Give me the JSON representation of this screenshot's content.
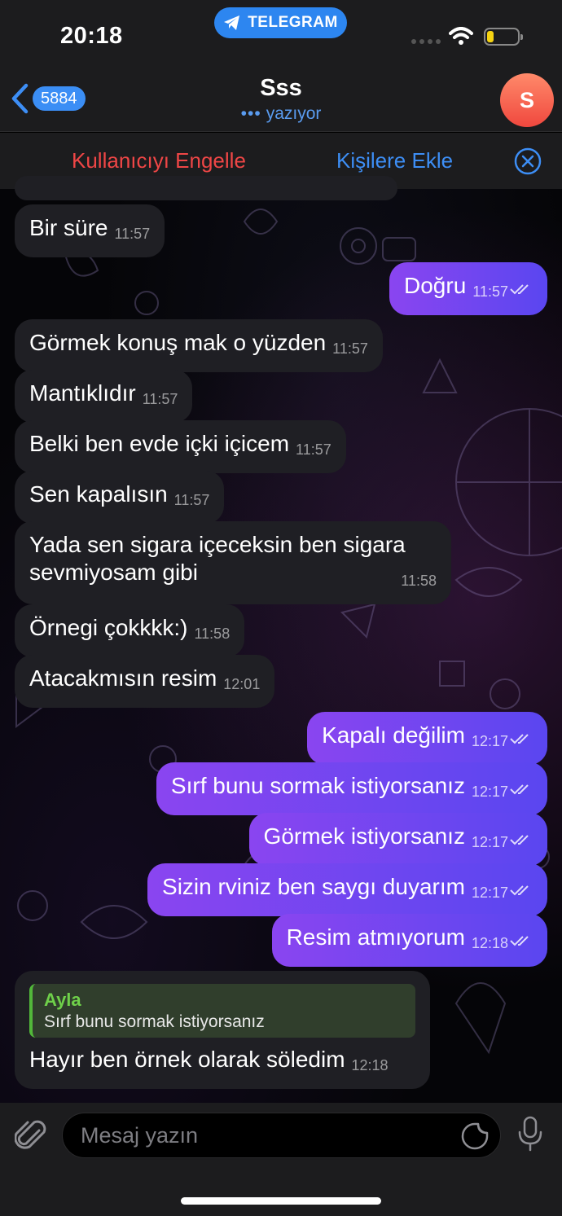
{
  "status_bar": {
    "time": "20:18",
    "app_pill": "TELEGRAM"
  },
  "header": {
    "back_count": "5884",
    "title": "Sss",
    "status": "yazıyor",
    "avatar_letter": "S",
    "avatar_color": "#f0483e"
  },
  "actions": {
    "block": "Kullanıcıyı Engelle",
    "add_contact": "Kişilere Ekle"
  },
  "messages": [
    {
      "dir": "in",
      "text": "Bir süre",
      "time": "11:57"
    },
    {
      "dir": "out",
      "text": "Doğru",
      "time": "11:57"
    },
    {
      "dir": "in",
      "text": "Görmek konuş mak o yüzden",
      "time": "11:57"
    },
    {
      "dir": "in",
      "text": "Mantıklıdır",
      "time": "11:57"
    },
    {
      "dir": "in",
      "text": "Belki ben evde içki içicem",
      "time": "11:57"
    },
    {
      "dir": "in",
      "text": "Sen kapalısın",
      "time": "11:57"
    },
    {
      "dir": "in",
      "text_line1": "Yada sen sigara içeceksin ben sigara",
      "text_line2": "sevmiyosam gibi",
      "time": "11:58"
    },
    {
      "dir": "in",
      "text": "Örnegi çokkkk:)",
      "time": "11:58"
    },
    {
      "dir": "in",
      "text": "Atacakmısın resim",
      "time": "12:01"
    },
    {
      "dir": "out",
      "text": "Kapalı değilim",
      "time": "12:17"
    },
    {
      "dir": "out",
      "text": "Sırf bunu sormak istiyorsanız",
      "time": "12:17"
    },
    {
      "dir": "out",
      "text": "Görmek istiyorsanız",
      "time": "12:17"
    },
    {
      "dir": "out",
      "text": "Sizin rviniz ben saygı duyarım",
      "time": "12:17"
    },
    {
      "dir": "out",
      "text": "Resim atmıyorum",
      "time": "12:18"
    },
    {
      "dir": "in",
      "reply_name": "Ayla",
      "reply_text": "Sırf bunu sormak istiyorsanız",
      "text": "Hayır ben örnek olarak söledim",
      "time": "12:18"
    }
  ],
  "composer": {
    "placeholder": "Mesaj yazın"
  },
  "colors": {
    "accent": "#3d8ef5",
    "danger": "#ef4646",
    "outgoing_start": "#8a45f0",
    "outgoing_end": "#5a46f0",
    "reply_name": "#6fd04a"
  }
}
